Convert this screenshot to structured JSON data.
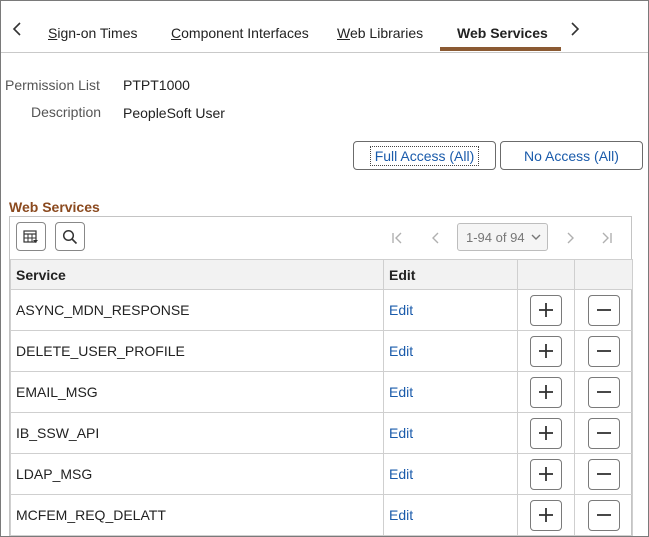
{
  "tabs": {
    "items": [
      {
        "label": "Sign-on Times",
        "ul": "S",
        "rest": "ign-on Times"
      },
      {
        "label": "Component Interfaces",
        "ul": "C",
        "rest": "omponent Interfaces"
      },
      {
        "label": "Web Libraries",
        "ul": "W",
        "rest": "eb Libraries"
      },
      {
        "label": "Web Services",
        "active": true
      }
    ],
    "prev_icon": "chevron-left-icon",
    "next_icon": "chevron-right-icon"
  },
  "fields": {
    "permission_list_label": "Permission List",
    "permission_list_value": "PTPT1000",
    "description_label": "Description",
    "description_value": "PeopleSoft User"
  },
  "buttons": {
    "full_access": "Full Access (All)",
    "no_access": "No Access (All)"
  },
  "grid": {
    "title": "Web Services",
    "pager_text": "1-94 of 94",
    "columns": [
      "Service",
      "Edit",
      "",
      ""
    ],
    "rows": [
      {
        "service": "ASYNC_MDN_RESPONSE",
        "edit": "Edit"
      },
      {
        "service": "DELETE_USER_PROFILE",
        "edit": "Edit"
      },
      {
        "service": "EMAIL_MSG",
        "edit": "Edit"
      },
      {
        "service": "IB_SSW_API",
        "edit": "Edit"
      },
      {
        "service": "LDAP_MSG",
        "edit": "Edit"
      },
      {
        "service": "MCFEM_REQ_DELATT",
        "edit": "Edit"
      }
    ]
  },
  "colors": {
    "accent": "#8b5a33",
    "link": "#1a5bab",
    "section_title": "#8b4a1f"
  }
}
